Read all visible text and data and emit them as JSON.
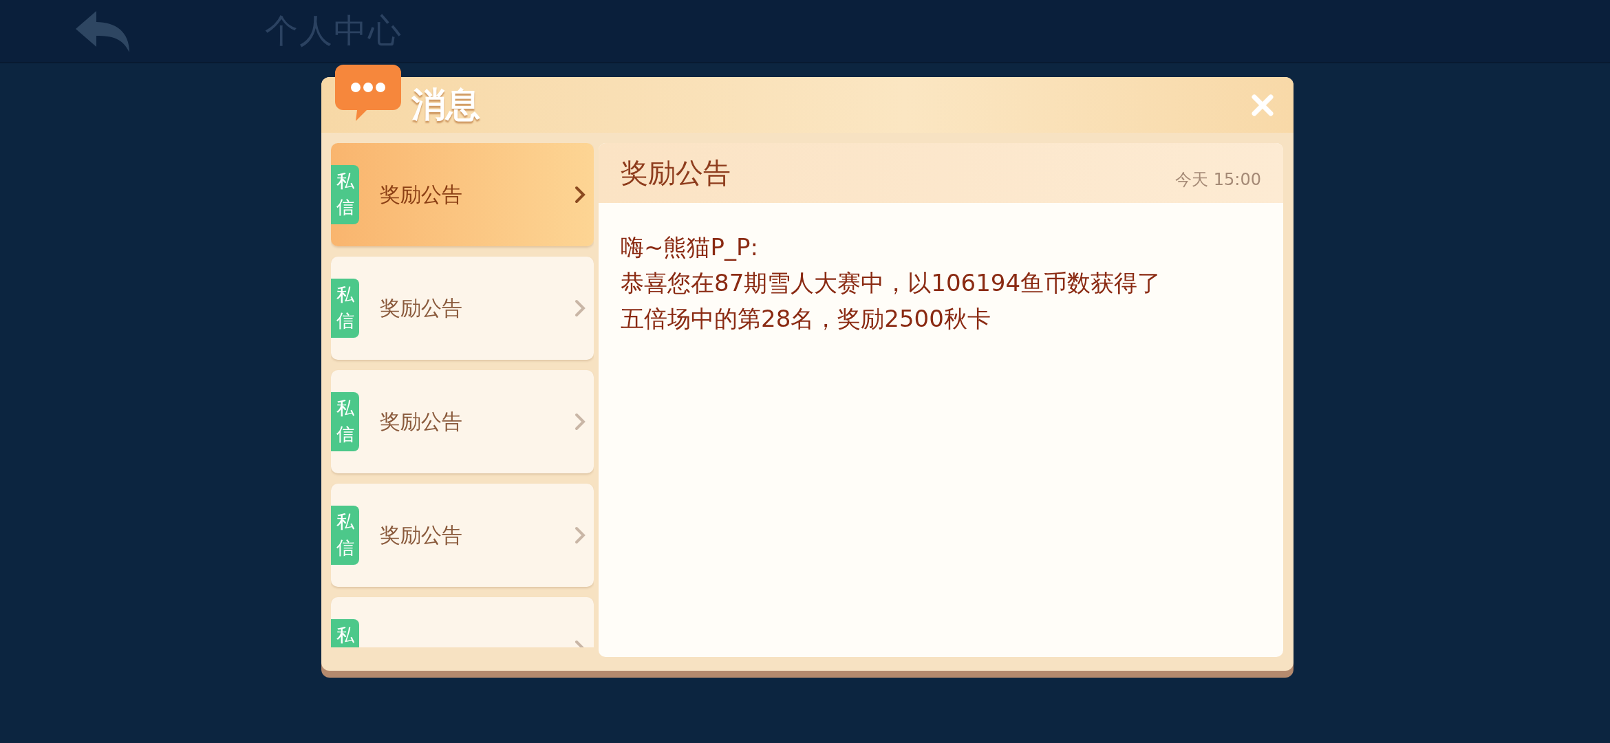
{
  "top_bar": {
    "title": "个人中心"
  },
  "dialog": {
    "title": "消息",
    "messages": [
      {
        "tag": "私信",
        "title": "奖励公告",
        "selected": true
      },
      {
        "tag": "私信",
        "title": "奖励公告",
        "selected": false
      },
      {
        "tag": "私信",
        "title": "奖励公告",
        "selected": false
      },
      {
        "tag": "私信",
        "title": "奖励公告",
        "selected": false
      },
      {
        "tag": "私",
        "selected": false
      }
    ],
    "detail": {
      "title": "奖励公告",
      "time": "今天 15:00",
      "lines": [
        "嗨~熊猫P_P:",
        "恭喜您在87期雪人大赛中，以106194鱼币数获得了",
        "五倍场中的第28名，奖励2500秋卡"
      ]
    }
  }
}
